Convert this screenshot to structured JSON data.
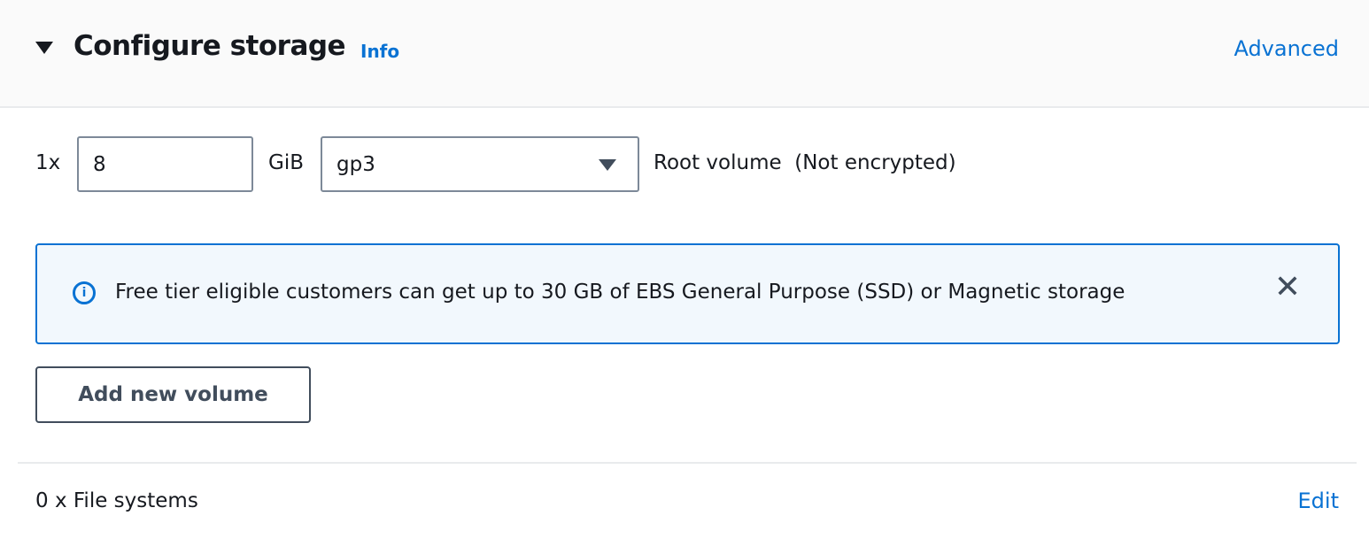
{
  "header": {
    "title": "Configure storage",
    "info_label": "Info",
    "advanced_label": "Advanced"
  },
  "volume": {
    "count_label": "1x",
    "size_value": "8",
    "unit_label": "GiB",
    "type_selected": "gp3",
    "description": "Root volume  (Not encrypted)"
  },
  "alert": {
    "icon": "info-circle-icon",
    "text": "Free tier eligible customers can get up to 30 GB of EBS General Purpose (SSD) or Magnetic storage",
    "close_icon": "close-icon"
  },
  "actions": {
    "add_volume_label": "Add new volume"
  },
  "file_systems": {
    "label": "0 x File systems",
    "edit_label": "Edit"
  },
  "colors": {
    "accent": "#0972d3",
    "alert_bg": "#f2f8fd",
    "header_bg": "#fafafa"
  }
}
